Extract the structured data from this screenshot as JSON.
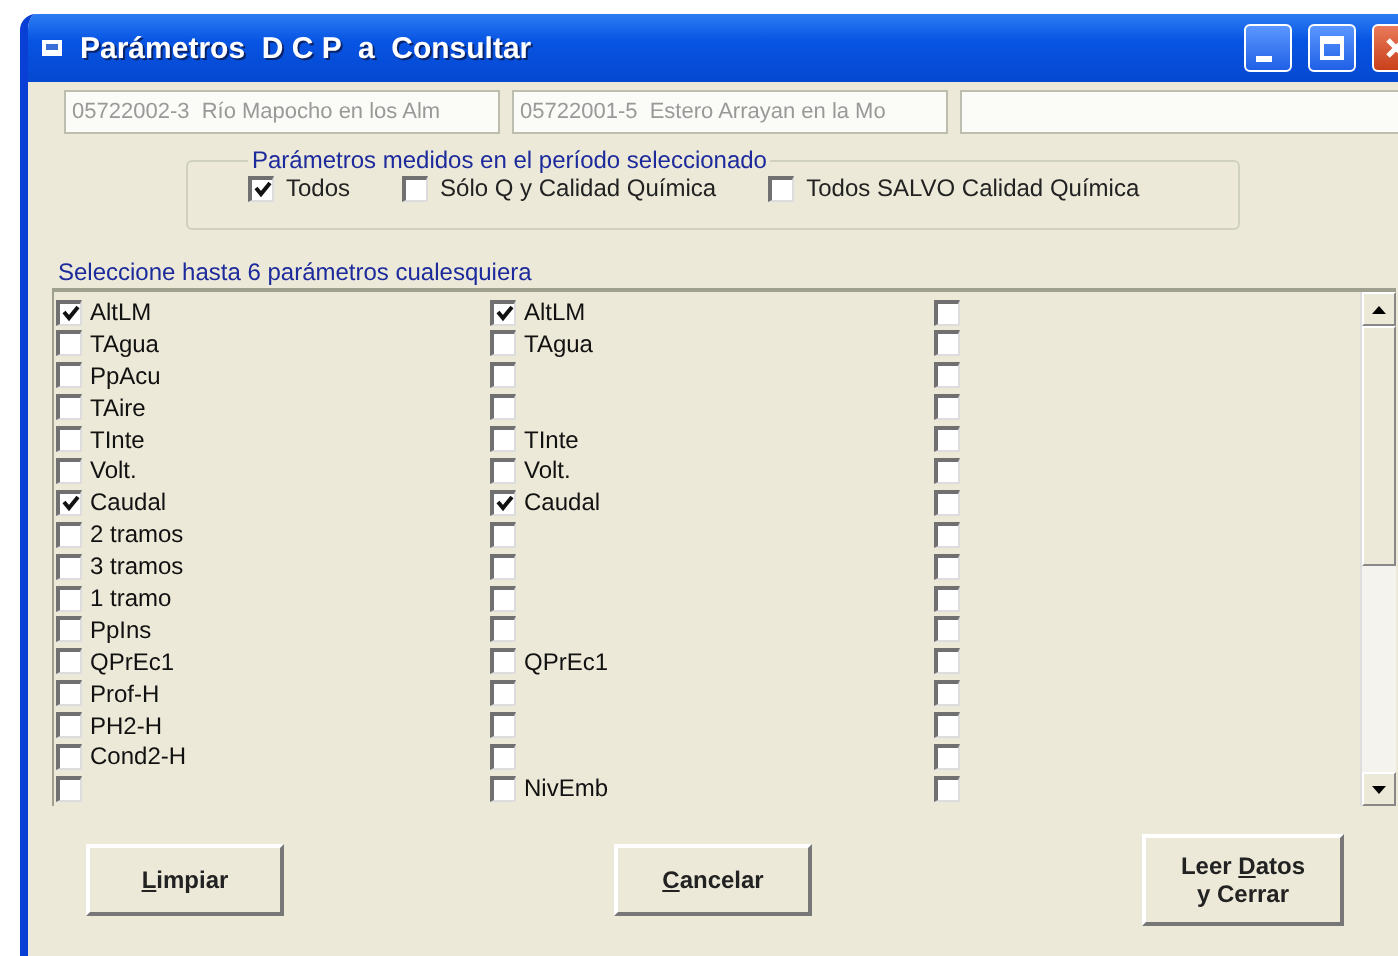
{
  "window": {
    "title": "Parámetros  D C P  a  Consultar"
  },
  "stations": [
    "05722002-3  Río Mapocho en los Alm",
    "05722001-5  Estero Arrayan en la Mo"
  ],
  "filter": {
    "title": "Parámetros medidos en el período seleccionado",
    "options": [
      {
        "label": "Todos",
        "checked": true
      },
      {
        "label": "Sólo Q y Calidad Química",
        "checked": false
      },
      {
        "label": "Todos SALVO Calidad Química",
        "checked": false
      }
    ]
  },
  "params": {
    "title": "Seleccione hasta 6 parámetros cualesquiera",
    "rows": [
      {
        "cells": [
          {
            "label": "AltLM",
            "checked": true
          },
          {
            "label": "AltLM",
            "checked": true
          },
          {
            "checked": false
          }
        ]
      },
      {
        "cells": [
          {
            "label": "TAgua",
            "checked": false
          },
          {
            "label": "TAgua",
            "checked": false
          },
          {
            "checked": false
          }
        ]
      },
      {
        "cells": [
          {
            "label": "PpAcu",
            "checked": false
          },
          {
            "checked": false
          },
          {
            "checked": false
          }
        ]
      },
      {
        "cells": [
          {
            "label": "TAire",
            "checked": false
          },
          {
            "checked": false
          },
          {
            "checked": false
          }
        ]
      },
      {
        "cells": [
          {
            "label": "TInte",
            "checked": false
          },
          {
            "label": "TInte",
            "checked": false
          },
          {
            "checked": false
          }
        ]
      },
      {
        "cells": [
          {
            "label": "Volt.",
            "checked": false
          },
          {
            "label": "Volt.",
            "checked": false
          },
          {
            "checked": false
          }
        ]
      },
      {
        "cells": [
          {
            "label": "Caudal",
            "checked": true
          },
          {
            "label": "Caudal",
            "checked": true
          },
          {
            "checked": false
          }
        ]
      },
      {
        "cells": [
          {
            "label": "2 tramos",
            "checked": false
          },
          {
            "checked": false
          },
          {
            "checked": false
          }
        ]
      },
      {
        "cells": [
          {
            "label": "3 tramos",
            "checked": false
          },
          {
            "checked": false
          },
          {
            "checked": false
          }
        ]
      },
      {
        "cells": [
          {
            "label": "1 tramo",
            "checked": false
          },
          {
            "checked": false
          },
          {
            "checked": false
          }
        ]
      },
      {
        "cells": [
          {
            "label": "PpIns",
            "checked": false
          },
          {
            "checked": false
          },
          {
            "checked": false
          }
        ]
      },
      {
        "cells": [
          {
            "label": "QPrEc1",
            "checked": false
          },
          {
            "label": "QPrEc1",
            "checked": false
          },
          {
            "checked": false
          }
        ]
      },
      {
        "cells": [
          {
            "label": "Prof-H",
            "checked": false
          },
          {
            "checked": false
          },
          {
            "checked": false
          }
        ]
      },
      {
        "cells": [
          {
            "label": "PH2-H",
            "checked": false
          },
          {
            "checked": false
          },
          {
            "checked": false
          }
        ]
      },
      {
        "cells": [
          {
            "label": "Cond2-H",
            "checked": false
          },
          {
            "checked": false
          },
          {
            "checked": false
          }
        ]
      },
      {
        "cells": [
          {
            "checked": false
          },
          {
            "label": "NivEmb",
            "checked": false
          },
          {
            "checked": false
          }
        ]
      }
    ]
  },
  "buttons": [
    {
      "key": "L",
      "post": "impiar"
    },
    {
      "key": "C",
      "post": "ancelar"
    },
    {
      "pre": "Leer ",
      "key": "D",
      "post": "atos",
      "line2": "y Cerrar"
    }
  ]
}
